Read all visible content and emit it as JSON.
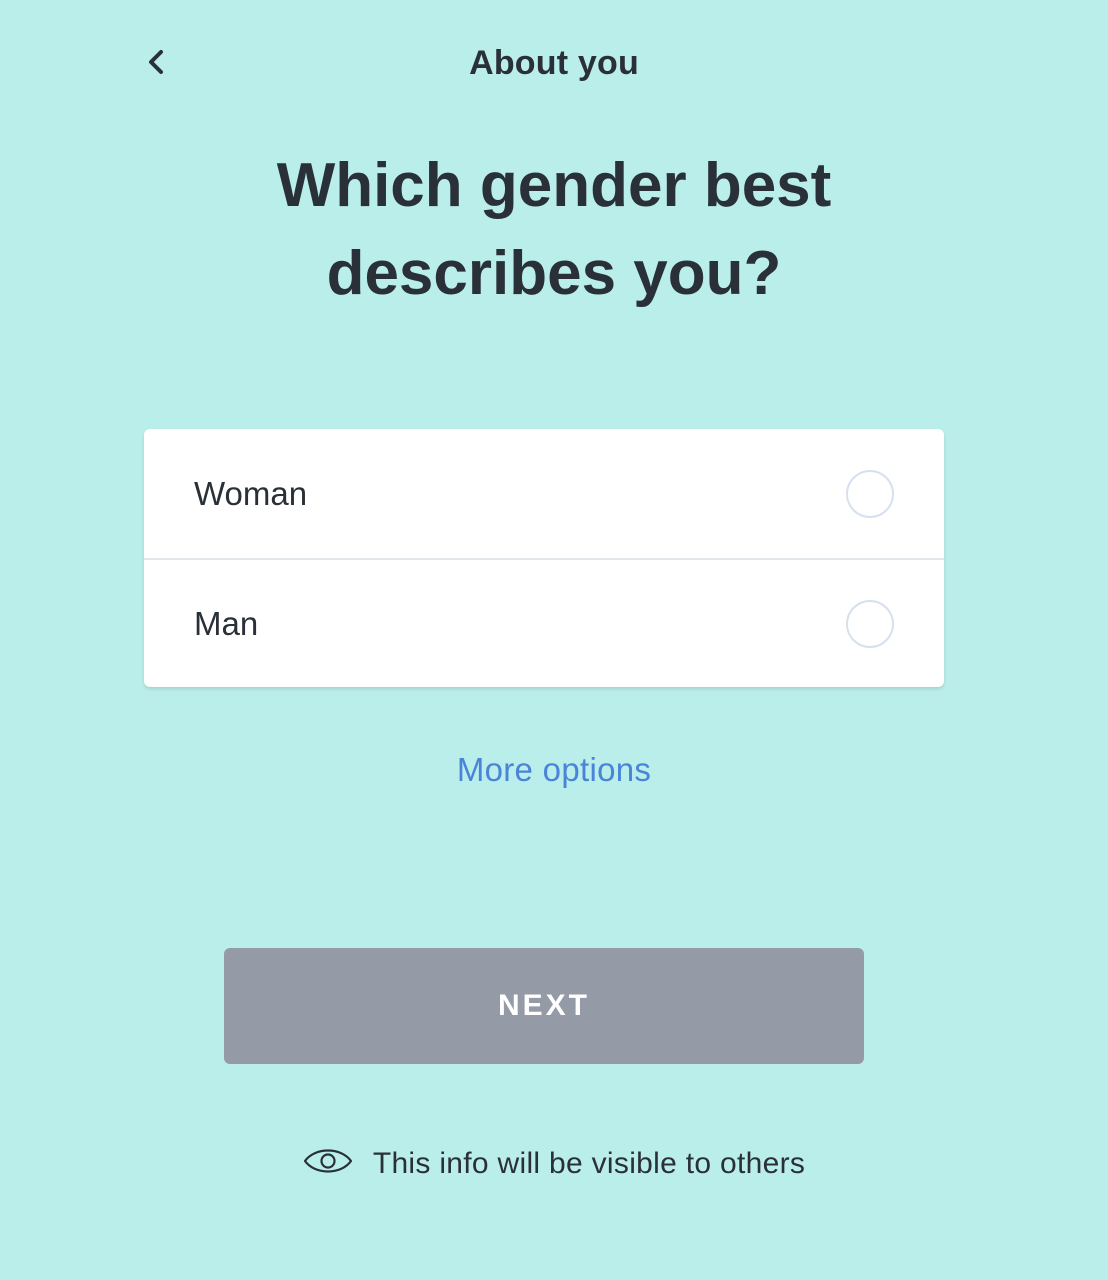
{
  "header": {
    "title": "About you",
    "back_icon": "chevron-left-icon"
  },
  "question": "Which gender best describes you?",
  "options": [
    {
      "label": "Woman",
      "selected": false
    },
    {
      "label": "Man",
      "selected": false
    }
  ],
  "more_options_label": "More options",
  "next_button_label": "NEXT",
  "visibility_note": {
    "icon": "eye-icon",
    "text": "This info will be visible to others"
  },
  "colors": {
    "background": "#baeeea",
    "text": "#2a3038",
    "link": "#4a84d9",
    "button_disabled": "#949aa6"
  }
}
